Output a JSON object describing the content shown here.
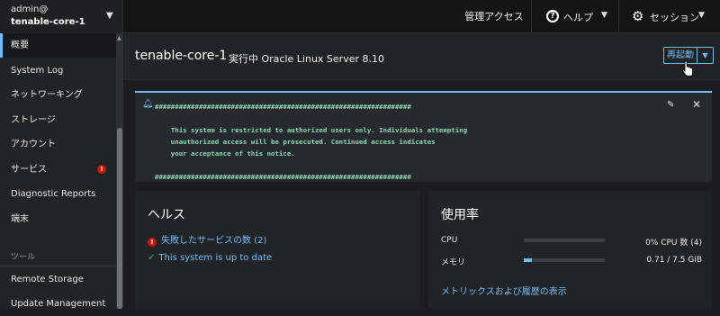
{
  "host_switcher": {
    "user": "admin@",
    "host": "tenable-core-1"
  },
  "topbar": {
    "admin_access": "管理アクセス",
    "help": "ヘルプ",
    "session": "セッション"
  },
  "sidebar": {
    "items": [
      {
        "label": "概要",
        "active": true
      },
      {
        "label": "System Log"
      },
      {
        "label": "ネットワーキング"
      },
      {
        "label": "ストレージ"
      },
      {
        "label": "アカウント"
      },
      {
        "label": "サービス",
        "badge": "!"
      },
      {
        "label": "Diagnostic Reports"
      },
      {
        "label": "端末"
      }
    ],
    "tools_section": "ツール",
    "tool_items": [
      {
        "label": "Remote Storage"
      },
      {
        "label": "Update Management"
      }
    ]
  },
  "header": {
    "hostname": "tenable-core-1",
    "status": "実行中 Oracle Linux Server 8.10",
    "restart_label": "再起動"
  },
  "motd": {
    "text": "################################################################\n\n    This system is restricted to authorized users only. Individuals attempting\n    unauthorized access will be prosecuted. Continued access indicates\n    your acceptance of this notice.\n\n################################################################"
  },
  "health": {
    "title": "ヘルス",
    "failed_services": "失敗したサービスの数 (2)",
    "up_to_date": "This system is up to date"
  },
  "usage": {
    "title": "使用率",
    "cpu_label": "CPU",
    "cpu_value": "0% CPU 数 (4)",
    "cpu_fraction": 0.0,
    "memory_label": "メモリ",
    "memory_value": "0.71 / 7.5 GiB",
    "memory_fraction": 0.095,
    "metrics_link": "メトリックスおよび履歴の表示"
  },
  "colors": {
    "accent": "#73bcf7",
    "danger": "#c9190b",
    "success": "#3e8635",
    "motd_text": "#8cd9b3"
  }
}
